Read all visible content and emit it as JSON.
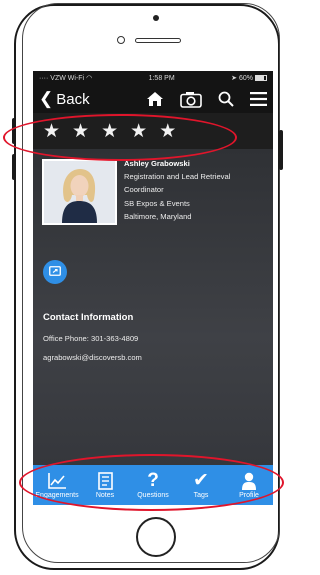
{
  "status": {
    "carrier": "VZW Wi-Fi",
    "time": "1:58 PM",
    "battery": "60%"
  },
  "nav": {
    "back_label": "Back"
  },
  "rating": {
    "stars": 5
  },
  "profile": {
    "name": "Ashley Grabowski",
    "title_line1": "Registration and Lead Retrieval",
    "title_line2": "Coordinator",
    "company": "SB Expos & Events",
    "location": "Baltimore, Maryland"
  },
  "contact": {
    "heading": "Contact Information",
    "phone": "Office Phone: 301-363-4809",
    "email": "agrabowski@discoversb.com"
  },
  "tabs": [
    {
      "label": "Engagements",
      "icon": "chart-icon"
    },
    {
      "label": "Notes",
      "icon": "notes-icon"
    },
    {
      "label": "Questions",
      "icon": "question-icon"
    },
    {
      "label": "Tags",
      "icon": "check-icon"
    },
    {
      "label": "Profile",
      "icon": "person-icon"
    }
  ],
  "colors": {
    "accent": "#2f8fe6",
    "annotation": "#e0152b",
    "bar": "#141414"
  }
}
